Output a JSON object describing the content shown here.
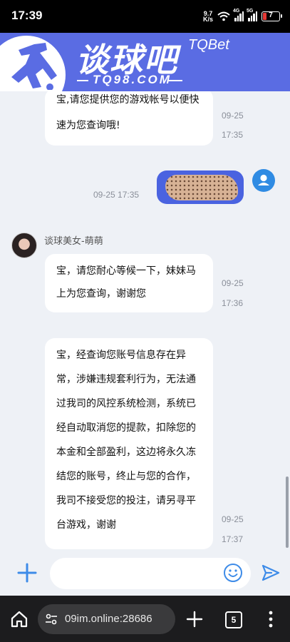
{
  "status_bar": {
    "time": "17:39",
    "net_speed_value": "9.7",
    "net_speed_unit": "K/s",
    "signal1_tag": "4G",
    "signal2_tag": "5G",
    "battery": "7"
  },
  "brand": {
    "name": "谈球吧",
    "english": "TQBet",
    "domain": "TQ98.COM"
  },
  "messages": [
    {
      "text_lines": [
        "宝,请您提供您的游戏帐号以便快",
        "速为您查询哦!"
      ],
      "date": "09-25",
      "time": "17:35"
    },
    {
      "sent_timestamp": "09-25 17:35"
    },
    {
      "sender": "谈球美女-萌萌"
    },
    {
      "text_lines": [
        "宝，请您耐心等候一下，妹妹马",
        "上为您查询，谢谢您"
      ],
      "date": "09-25",
      "time": "17:36"
    },
    {
      "text_lines": [
        "宝，经查询您账号信息存在异",
        "常，涉嫌违规套利行为，无法通",
        "过我司的风控系统检测，系统已",
        "经自动取消您的提款，扣除您的",
        "本金和全部盈利，这边将永久冻",
        "结您的账号，终止与您的合作，",
        "我司不接受您的投注，请另寻平",
        "台游戏，谢谢"
      ],
      "date": "09-25",
      "time": "17:37"
    }
  ],
  "input": {
    "value": "",
    "placeholder": ""
  },
  "browser": {
    "url": "09im.online:28686",
    "tab_count": "5"
  },
  "icons": {
    "plus": "plus-icon",
    "emoji": "emoji-icon",
    "send": "send-icon",
    "home": "home-icon",
    "tune": "tune-icon",
    "new_tab": "plus-icon",
    "menu": "more-vertical-icon"
  },
  "colors": {
    "brand_bg": "#5a6ce3",
    "sent_bubble": "#4a63e0",
    "accent_icon": "#3d8be8"
  }
}
